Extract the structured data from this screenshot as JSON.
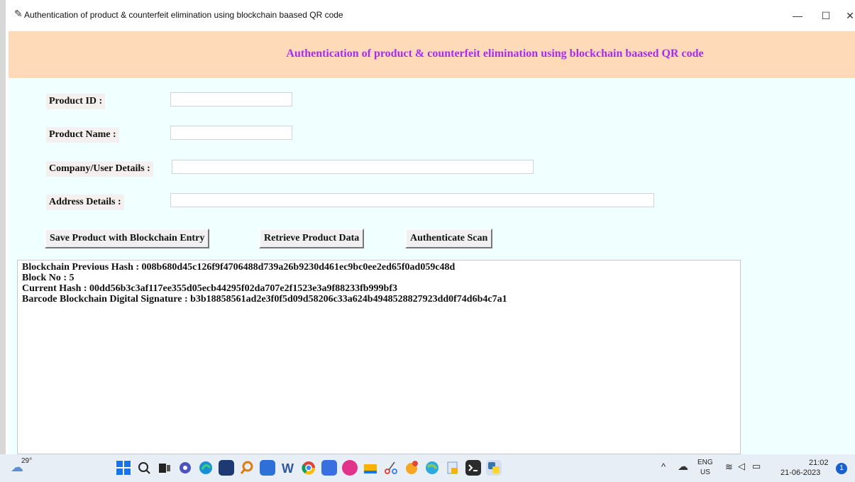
{
  "window": {
    "title": "Authentication of product & counterfeit elimination using blockchain baased QR code",
    "minimize_glyph": "—",
    "maximize_glyph": "☐",
    "close_glyph": "✕",
    "app_icon": "feather-icon"
  },
  "header": {
    "heading": "Authentication of product & counterfeit elimination using blockchain baased QR code",
    "heading_color": "#a82cf0",
    "background": "#ffdab9"
  },
  "form": {
    "product_id_label": "Product ID :",
    "product_id_value": "",
    "product_name_label": "Product Name :",
    "product_name_value": "",
    "company_label": "Company/User Details :",
    "company_value": "",
    "address_label": "Address Details :",
    "address_value": ""
  },
  "buttons": {
    "save": "Save Product with Blockchain Entry",
    "retrieve": "Retrieve Product Data",
    "authenticate": "Authenticate Scan"
  },
  "output": {
    "lines": [
      "Blockchain Previous Hash : 008b680d45c126f9f4706488d739a26b9230d461ec9bc0ee2ed65f0ad059c48d",
      "Block No : 5",
      "Current Hash : 00dd56b3c3af117ee355d05ecb44295f02da707e2f1523e3a9f88233fb999bf3",
      "Barcode Blockchain Digital Signature : b3b18858561ad2e3f0f5d09d58206c33a624b4948528827923dd0f74d6b4c7a1"
    ]
  },
  "taskbar": {
    "weather_temp": "29°",
    "weather_icon": "cloud-icon",
    "language_line1": "ENG",
    "language_line2": "US",
    "time": "21:02",
    "date": "21-06-2023",
    "notification_count": "1",
    "pinned_apps": [
      "start-icon",
      "search-icon",
      "task-view-icon",
      "chat-icon",
      "edge-icon",
      "store-icon",
      "search-app-icon",
      "calculator-icon",
      "word-icon",
      "chrome-icon",
      "app-icon",
      "app-icon-2",
      "files-icon",
      "snipping-icon",
      "paint-icon",
      "maps-icon",
      "notepad-icon",
      "terminal-icon",
      "python-icon"
    ]
  }
}
